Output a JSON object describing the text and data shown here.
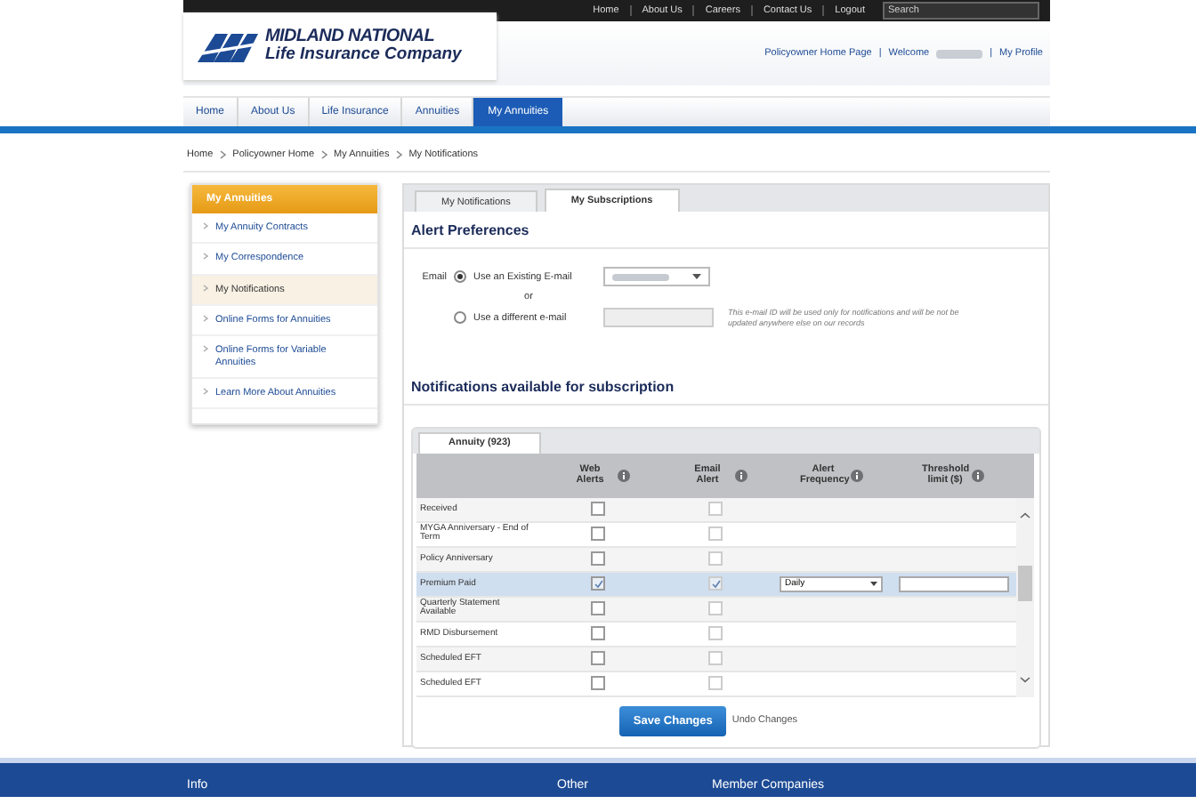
{
  "top_links": [
    "Home",
    "About Us",
    "Careers",
    "Contact Us",
    "Logout"
  ],
  "search": {
    "placeholder": "Search"
  },
  "logo": {
    "line1": "MIDLAND NATIONAL",
    "line2": "Life Insurance Company"
  },
  "header_links": [
    {
      "kind": "link",
      "text": "Policyowner Home Page"
    },
    {
      "kind": "sep",
      "text": "|"
    },
    {
      "kind": "welcome",
      "text": "Welcome"
    },
    {
      "kind": "sep",
      "text": "|"
    },
    {
      "kind": "link",
      "text": "My Profile"
    }
  ],
  "nav": [
    {
      "label": "Home",
      "selected": false
    },
    {
      "label": "About Us",
      "selected": false
    },
    {
      "label": "Life Insurance",
      "selected": false
    },
    {
      "label": "Annuities",
      "selected": false
    },
    {
      "label": "My Annuities",
      "selected": true
    }
  ],
  "breadcrumb": [
    "Home",
    "Policyowner Home",
    "My Annuities",
    "My Notifications"
  ],
  "sidebar": {
    "title": "My Annuities",
    "items": [
      {
        "label": "My Annuity Contracts",
        "selected": false
      },
      {
        "label": "My Correspondence",
        "selected": false
      },
      {
        "label": "My Notifications",
        "selected": true
      },
      {
        "label": "Online Forms for Annuities",
        "selected": false
      },
      {
        "label": "Online Forms for Variable Annuities",
        "selected": false
      },
      {
        "label": "Learn More About Annuities",
        "selected": false
      }
    ]
  },
  "tabs": [
    {
      "label": "My Notifications",
      "selected": false
    },
    {
      "label": "My Subscriptions",
      "selected": true
    }
  ],
  "alert_preferences": {
    "heading": "Alert Preferences",
    "email_label": "Email",
    "or": "or",
    "options": [
      {
        "kind": "select",
        "label": "Use an Existing E-mail",
        "selected": true
      },
      {
        "kind": "input",
        "label": "Use a different e-mail",
        "selected": false
      }
    ],
    "note": "This e-mail ID will be used only for notifications and will be not be updated anywhere else on our records"
  },
  "notifications": {
    "heading": "Notifications available for subscription",
    "tab": "Annuity (923)",
    "columns": [
      "Web Alerts",
      "Email Alert",
      "Alert Frequency",
      "Threshold limit ($)"
    ],
    "rows": [
      {
        "name": "Received",
        "web_alert": false,
        "email_alert": false,
        "selected": false
      },
      {
        "name": "MYGA Anniversary - End of Term",
        "web_alert": false,
        "email_alert": false,
        "selected": false
      },
      {
        "name": "Policy Anniversary",
        "web_alert": false,
        "email_alert": false,
        "selected": false
      },
      {
        "name": "Premium Paid",
        "web_alert": true,
        "email_alert": true,
        "selected": true,
        "frequency": "Daily"
      },
      {
        "name": "Quarterly Statement Available",
        "web_alert": false,
        "email_alert": false,
        "selected": false
      },
      {
        "name": "RMD Disbursement",
        "web_alert": false,
        "email_alert": false,
        "selected": false
      },
      {
        "name": "Scheduled EFT",
        "web_alert": false,
        "email_alert": false,
        "selected": false
      },
      {
        "name": "Scheduled EFT",
        "web_alert": false,
        "email_alert": false,
        "selected": false
      }
    ]
  },
  "buttons": {
    "save": "Save Changes",
    "undo": "Undo Changes"
  },
  "footer": [
    "Info",
    "Other",
    "Member Companies"
  ]
}
